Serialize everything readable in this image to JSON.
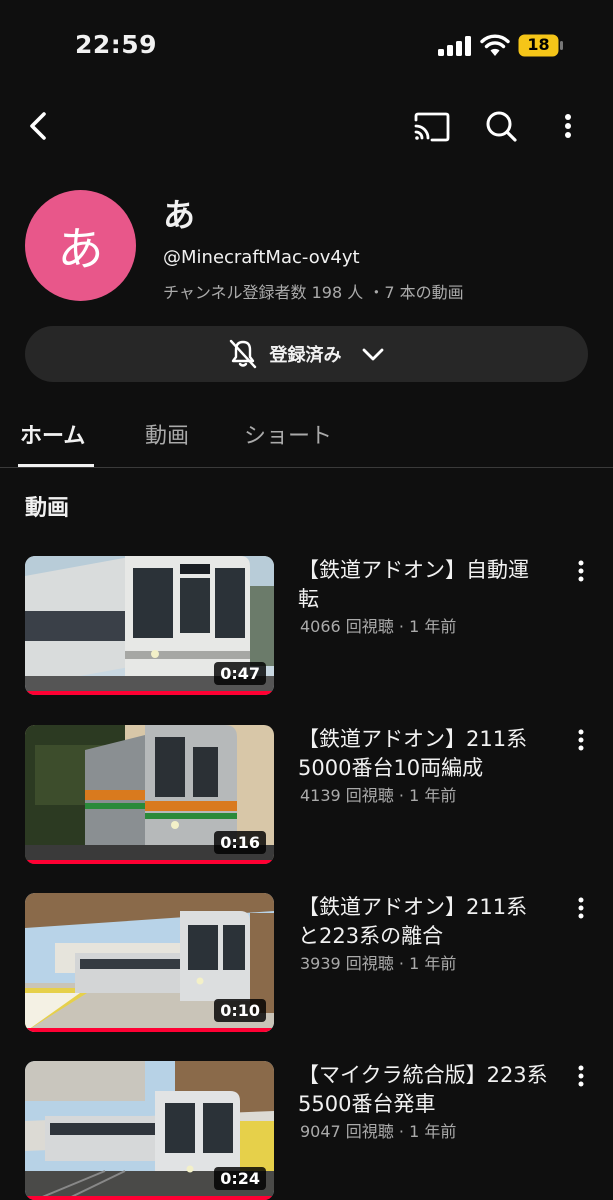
{
  "status": {
    "time": "22:59",
    "battery": "18"
  },
  "channel": {
    "avatar_letter": "あ",
    "name": "あ",
    "handle": "@MinecraftMac-ov4yt",
    "meta": "チャンネル登録者数 198 人 ・7 本の動画",
    "subscribe_label": "登録済み"
  },
  "tabs": [
    {
      "label": "ホーム",
      "active": true
    },
    {
      "label": "動画",
      "active": false
    },
    {
      "label": "ショート",
      "active": false
    }
  ],
  "section_title": "動画",
  "videos": [
    {
      "title": "【鉄道アドオン】自動運転",
      "meta": "4066 回視聴 · 1 年前",
      "duration": "0:47"
    },
    {
      "title": "【鉄道アドオン】211系 5000番台10両編成",
      "meta": "4139 回視聴 · 1 年前",
      "duration": "0:16"
    },
    {
      "title": "【鉄道アドオン】211系と223系の離合",
      "meta": "3939 回視聴 · 1 年前",
      "duration": "0:10"
    },
    {
      "title": "【マイクラ統合版】223系5500番台発車",
      "meta": "9047 回視聴 · 1 年前",
      "duration": "0:24"
    }
  ]
}
